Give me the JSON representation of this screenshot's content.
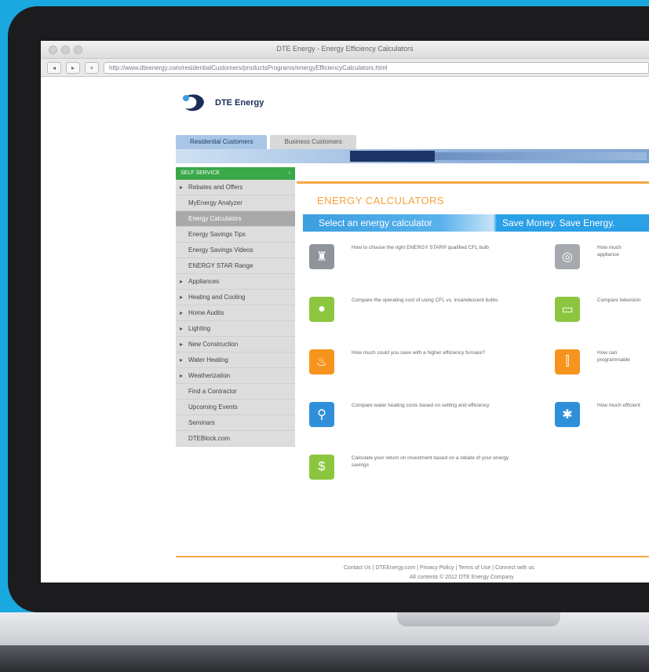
{
  "browser": {
    "window_title": "DTE Energy - Energy Efficiency Calculators",
    "url": "http://www.dteenergy.com/residentialCustomers/productsPrograms/energyEfficiencyCalculators.html"
  },
  "site": {
    "logo_text": "DTE Energy",
    "customer_tabs": [
      "Residential Customers",
      "Business Customers"
    ]
  },
  "sidebar": {
    "header": "SELF SERVICE",
    "header_arrow": "›",
    "items": [
      {
        "label": "Rebates and Offers",
        "arrow": true
      },
      {
        "label": "MyEnergy Analyzer",
        "arrow": false
      },
      {
        "label": "Energy Calculators",
        "arrow": false,
        "active": true
      },
      {
        "label": "Energy Savings Tips",
        "arrow": false
      },
      {
        "label": "Energy Savings Videos",
        "arrow": false
      },
      {
        "label": "ENERGY STAR Range",
        "arrow": false
      },
      {
        "label": "Appliances",
        "arrow": true
      },
      {
        "label": "Heating and Cooling",
        "arrow": true
      },
      {
        "label": "Home Audits",
        "arrow": true
      },
      {
        "label": "Lighting",
        "arrow": true
      },
      {
        "label": "New Construction",
        "arrow": true
      },
      {
        "label": "Water Heating",
        "arrow": true
      },
      {
        "label": "Weatherization",
        "arrow": true
      },
      {
        "label": "Find a Contractor",
        "arrow": false
      },
      {
        "label": "Upcoming Events",
        "arrow": false
      },
      {
        "label": "Seminars",
        "arrow": false
      },
      {
        "label": "DTEBlock.com",
        "arrow": false
      }
    ]
  },
  "main": {
    "heading": "ENERGY CALCULATORS",
    "bar_left": "Select an energy calculator",
    "bar_right": "Save Money. Save Energy.",
    "calculators_left": [
      {
        "text": "How to choose the right ENERGY STAR® qualified CFL bulb",
        "color": "#8f949a",
        "icon": "lamp-icon",
        "glyph": "♜"
      },
      {
        "text": "Compare the operating cost of using CFL vs. incandescent bulbs",
        "color": "#8cc63f",
        "icon": "bulb-icon",
        "glyph": "●"
      },
      {
        "text": "How much could you save with a higher efficiency furnace?",
        "color": "#f7941d",
        "icon": "flame-icon",
        "glyph": "♨"
      },
      {
        "text": "Compare water heating costs based on setting and efficiency",
        "color": "#2f8fd8",
        "icon": "faucet-icon",
        "glyph": "⚲"
      },
      {
        "text": "Calculate your return on investment based on a rebate of your energy savings",
        "color": "#8cc63f",
        "icon": "money-icon",
        "glyph": "$"
      }
    ],
    "calculators_right": [
      {
        "text": "How much appliance",
        "color": "#a6a9ad",
        "icon": "appliance-icon",
        "glyph": "◎"
      },
      {
        "text": "Compare television",
        "color": "#8cc63f",
        "icon": "tv-icon",
        "glyph": "▭"
      },
      {
        "text": "How can programmable",
        "color": "#f7941d",
        "icon": "thermometer-icon",
        "glyph": "⫿"
      },
      {
        "text": "How much efficient",
        "color": "#2f8fd8",
        "icon": "snowflake-icon",
        "glyph": "✱"
      }
    ]
  },
  "footer": {
    "links": "Contact Us | DTEEnergy.com | Privacy Policy | Terms of Use | Connect with us",
    "copyright": "All contents © 2012 DTE Energy Company"
  }
}
